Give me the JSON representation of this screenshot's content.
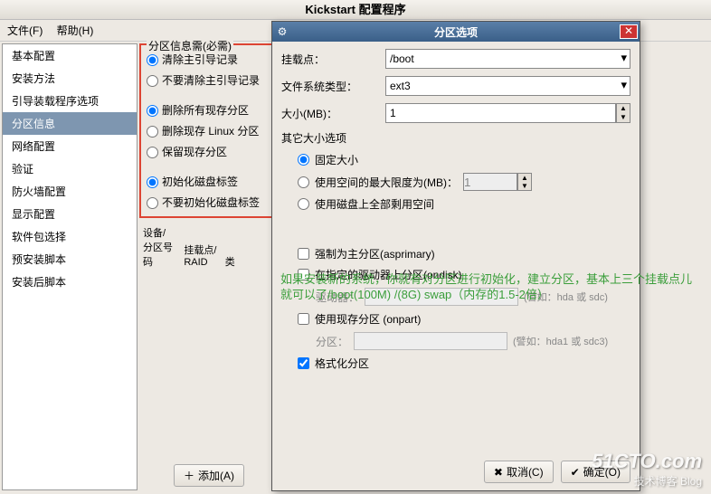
{
  "main": {
    "title": "Kickstart 配置程序",
    "menu": {
      "file": "文件(F)",
      "help": "帮助(H)"
    },
    "sidebar": [
      "基本配置",
      "安装方法",
      "引导装载程序选项",
      "分区信息",
      "网络配置",
      "验证",
      "防火墙配置",
      "显示配置",
      "软件包选择",
      "预安装脚本",
      "安装后脚本"
    ],
    "selected_index": 3,
    "center": {
      "group_label": "分区信息需(必需)",
      "r1a": "清除主引导记录",
      "r1b": "不要清除主引导记录",
      "r2a": "删除所有现存分区",
      "r2b": "删除现存 Linux 分区",
      "r2c": "保留现存分区",
      "r3a": "初始化磁盘标签",
      "r3b": "不要初始化磁盘标签",
      "device_l1": "设备/",
      "device_l2": "分区号码",
      "mount_l1": "挂载点/",
      "mount_l2": "RAID",
      "type_l1": "类",
      "add_btn": "添加(A)"
    }
  },
  "dialog": {
    "title": "分区选项",
    "mount_label": "挂载点：",
    "mount_value": "/boot",
    "fstype_label": "文件系统类型：",
    "fstype_value": "ext3",
    "size_label": "大小(MB)：",
    "size_value": "1",
    "other_label": "其它大小选项",
    "opt_fixed": "固定大小",
    "opt_maxmb": "使用空间的最大限度为(MB)：",
    "opt_maxmb_val": "1",
    "opt_fill": "使用磁盘上全部剩用空间",
    "chk_asprimary": "强制为主分区(asprimary)",
    "chk_ondisk": "在指定的驱动器上分区(ondisk)",
    "ondisk_drive_label": "驱动器：",
    "ondisk_hint": "(譬如：hda 或 sdc)",
    "chk_onpart": "使用现存分区 (onpart)",
    "onpart_label": "分区：",
    "onpart_hint": "(譬如：hda1 或 sdc3)",
    "chk_format": "格式化分区",
    "cancel": "取消(C)",
    "ok": "确定(O)"
  },
  "annotation": "如果安装新的系统，你就有对分区进行初始化，建立分区，基本上三个挂载点儿就可以了/boot(100M)  /(8G)   swap（内存的1.5-2倍）",
  "watermark": {
    "main": "51CTO.com",
    "sub": "技术博客  Blog"
  }
}
